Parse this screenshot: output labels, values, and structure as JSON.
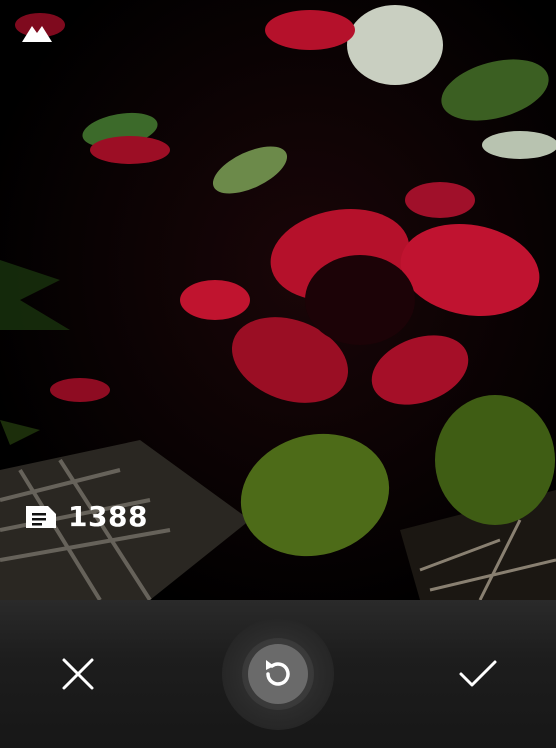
{
  "overlay": {
    "top_icon": "mountain-icon",
    "size_icon": "document-icon",
    "size_value": "1388"
  },
  "toolbar": {
    "cancel_icon": "close-icon",
    "retake_icon": "retake-icon",
    "confirm_icon": "checkmark-icon"
  },
  "colors": {
    "bar_background": "#1f1f1f",
    "icon_color": "#ffffff",
    "retake_circle": "#6a6a6a"
  }
}
